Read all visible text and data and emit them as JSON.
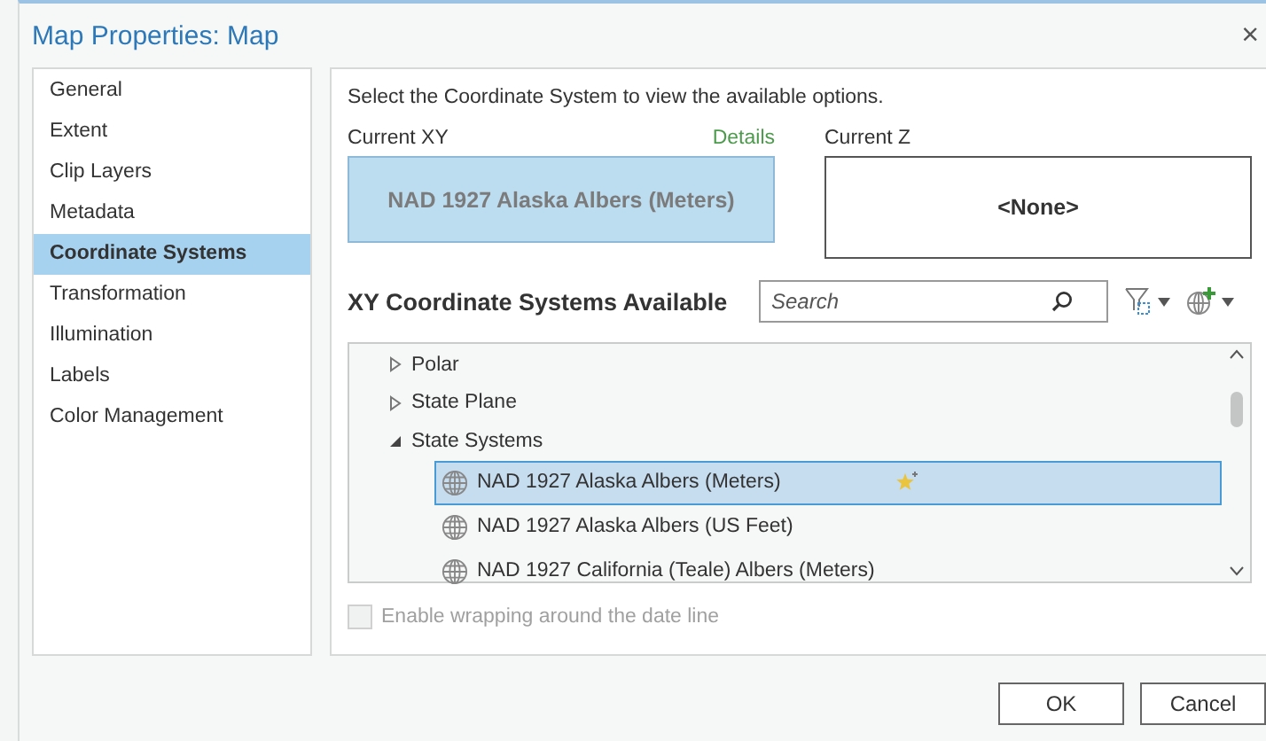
{
  "window": {
    "title": "Map Properties: Map",
    "close": "×"
  },
  "sidebar": {
    "items": [
      {
        "label": "General",
        "selected": false
      },
      {
        "label": "Extent",
        "selected": false
      },
      {
        "label": "Clip Layers",
        "selected": false
      },
      {
        "label": "Metadata",
        "selected": false
      },
      {
        "label": "Coordinate Systems",
        "selected": true
      },
      {
        "label": "Transformation",
        "selected": false
      },
      {
        "label": "Illumination",
        "selected": false
      },
      {
        "label": "Labels",
        "selected": false
      },
      {
        "label": "Color Management",
        "selected": false
      }
    ]
  },
  "instruction": "Select the Coordinate System to view the available options.",
  "current_xy": {
    "label": "Current XY",
    "details_link": "Details",
    "value": "NAD 1927 Alaska Albers (Meters)"
  },
  "current_z": {
    "label": "Current Z",
    "value": "<None>"
  },
  "available": {
    "heading": "XY Coordinate Systems Available",
    "search": {
      "placeholder": "Search"
    },
    "tree": [
      {
        "kind": "folder",
        "label": "Polar",
        "expanded": false
      },
      {
        "kind": "folder",
        "label": "State Plane",
        "expanded": false
      },
      {
        "kind": "folder",
        "label": "State Systems",
        "expanded": true,
        "children": [
          {
            "kind": "system",
            "label": "NAD 1927 Alaska Albers (Meters)",
            "selected": true,
            "favorite": true
          },
          {
            "kind": "system",
            "label": "NAD 1927 Alaska Albers (US Feet)",
            "selected": false,
            "favorite": false
          },
          {
            "kind": "system",
            "label": "NAD 1927 California (Teale) Albers (Meters)",
            "selected": false,
            "favorite": false
          }
        ]
      }
    ]
  },
  "wrap_option": {
    "label": "Enable wrapping around the date line",
    "checked": false,
    "disabled": true
  },
  "buttons": [
    "OK",
    "Cancel"
  ]
}
